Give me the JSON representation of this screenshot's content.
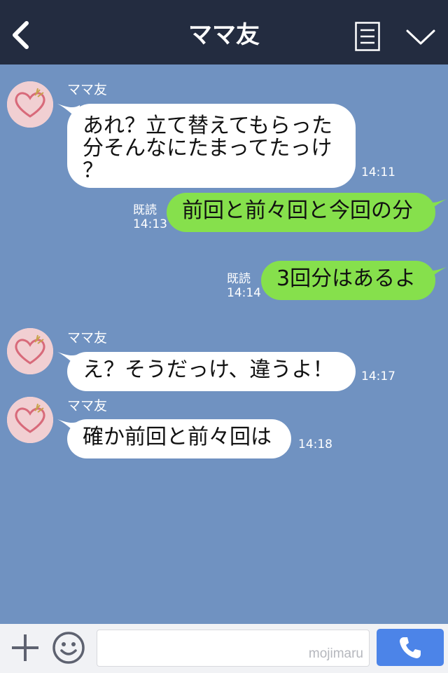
{
  "header": {
    "title": "ママ友",
    "back_icon": "chevron-left-icon",
    "menu_icon": "menu-list-icon",
    "collapse_icon": "chevron-down-icon"
  },
  "messages": [
    {
      "direction": "incoming",
      "sender": "ママ友",
      "text_lines": [
        "あれ？立て替えてもらった",
        "分そんなにたまってたっけ",
        "？"
      ],
      "time": "14:11"
    },
    {
      "direction": "outgoing",
      "read_label": "既読",
      "text": "前回と前々回と今回の分",
      "time": "14:13"
    },
    {
      "direction": "outgoing",
      "read_label": "既読",
      "text": "3回分はあるよ",
      "time": "14:14"
    },
    {
      "direction": "incoming",
      "sender": "ママ友",
      "text": "え？そうだっけ、違うよ！",
      "time": "14:17"
    },
    {
      "direction": "incoming",
      "sender": "ママ友",
      "text": "確か前回と前々回は",
      "time": "14:18"
    }
  ],
  "footer": {
    "input_value": "",
    "watermark": "mojimaru",
    "plus_icon": "plus-icon",
    "emoji_icon": "smiley-icon",
    "call_icon": "phone-icon"
  },
  "colors": {
    "header_bg": "#232c40",
    "chat_bg": "#7092c1",
    "outgoing_bubble": "#86e04c",
    "incoming_bubble": "#ffffff",
    "call_button": "#4c84e8"
  }
}
